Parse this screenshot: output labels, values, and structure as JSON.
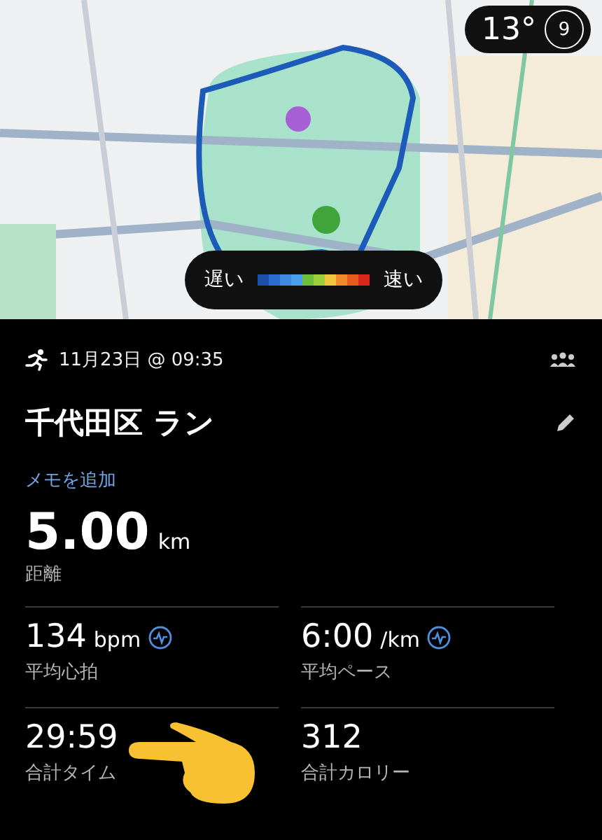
{
  "map": {
    "kind": "picture",
    "weather": {
      "temperature": "13°",
      "badge": "9"
    },
    "legend": {
      "slow": "遅い",
      "fast": "速い"
    }
  },
  "activity": {
    "date": "11月23日 @ 09:35",
    "title": "千代田区 ラン",
    "memo_link": "メモを追加"
  },
  "distance": {
    "value": "5.00",
    "unit": "km",
    "label": "距離"
  },
  "stats": [
    {
      "value": "134",
      "unit": "bpm",
      "label": "平均心拍",
      "chart_link": true
    },
    {
      "value": "6:00",
      "unit": "/km",
      "label": "平均ペース",
      "chart_link": true
    },
    {
      "value": "29:59",
      "label": "合計タイム",
      "chart_link": false
    },
    {
      "value": "312",
      "label": "合計カロリー",
      "chart_link": false
    }
  ]
}
